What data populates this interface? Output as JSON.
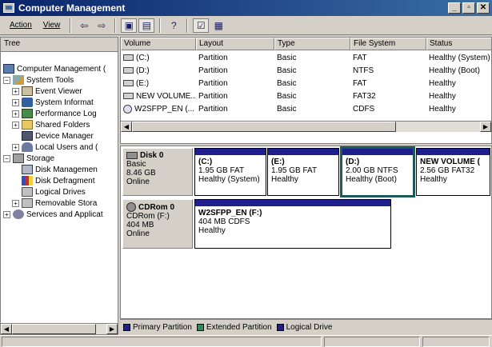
{
  "window": {
    "title": "Computer Management"
  },
  "menu": {
    "action": "Action",
    "view": "View"
  },
  "tree": {
    "header": "Tree",
    "items": [
      {
        "label": "Computer Management (",
        "icon": "computer-icon"
      },
      {
        "label": "System Tools",
        "icon": "tools-icon"
      },
      {
        "label": "Event Viewer",
        "icon": "event-viewer-icon"
      },
      {
        "label": "System Informat",
        "icon": "system-info-icon"
      },
      {
        "label": "Performance Log",
        "icon": "performance-icon"
      },
      {
        "label": "Shared Folders",
        "icon": "folder-icon"
      },
      {
        "label": "Device Manager",
        "icon": "device-manager-icon"
      },
      {
        "label": "Local Users and (",
        "icon": "users-icon"
      },
      {
        "label": "Storage",
        "icon": "storage-icon"
      },
      {
        "label": "Disk Managemen",
        "icon": "disk-management-icon"
      },
      {
        "label": "Disk Defragment",
        "icon": "defrag-icon"
      },
      {
        "label": "Logical Drives",
        "icon": "logical-drives-icon"
      },
      {
        "label": "Removable Stora",
        "icon": "removable-storage-icon"
      },
      {
        "label": "Services and Applicat",
        "icon": "services-icon"
      }
    ]
  },
  "volumes": {
    "columns": [
      "Volume",
      "Layout",
      "Type",
      "File System",
      "Status"
    ],
    "rows": [
      {
        "volume": "(C:)",
        "layout": "Partition",
        "type": "Basic",
        "fs": "FAT",
        "status": "Healthy (System)"
      },
      {
        "volume": "(D:)",
        "layout": "Partition",
        "type": "Basic",
        "fs": "NTFS",
        "status": "Healthy (Boot)"
      },
      {
        "volume": "(E:)",
        "layout": "Partition",
        "type": "Basic",
        "fs": "FAT",
        "status": "Healthy"
      },
      {
        "volume": "NEW VOLUME...",
        "layout": "Partition",
        "type": "Basic",
        "fs": "FAT32",
        "status": "Healthy"
      },
      {
        "volume": "W2SFPP_EN (...",
        "layout": "Partition",
        "type": "Basic",
        "fs": "CDFS",
        "status": "Healthy"
      }
    ]
  },
  "disks": {
    "disk0": {
      "name": "Disk 0",
      "type": "Basic",
      "size": "8.46 GB",
      "state": "Online",
      "partitions": [
        {
          "name": "(C:)",
          "size": "1.95 GB FAT",
          "status": "Healthy (System)"
        },
        {
          "name": "(E:)",
          "size": "1.95 GB FAT",
          "status": "Healthy"
        },
        {
          "name": "(D:)",
          "size": "2.00 GB NTFS",
          "status": "Healthy (Boot)"
        },
        {
          "name": "NEW VOLUME (",
          "size": "2.56 GB FAT32",
          "status": "Healthy"
        }
      ]
    },
    "cdrom0": {
      "name": "CDRom 0",
      "type": "CDRom (F:)",
      "size": "404 MB",
      "state": "Online",
      "partitions": [
        {
          "name": "W2SFPP_EN (F:)",
          "size": "404 MB CDFS",
          "status": "Healthy"
        }
      ]
    }
  },
  "legend": {
    "primary": "Primary Partition",
    "extended": "Extended Partition",
    "logical": "Logical Drive"
  },
  "colors": {
    "primary": "#1e1e8c",
    "extended": "#2e8b57",
    "logical": "#1e1e8c",
    "selected": "#1a5a5a"
  }
}
